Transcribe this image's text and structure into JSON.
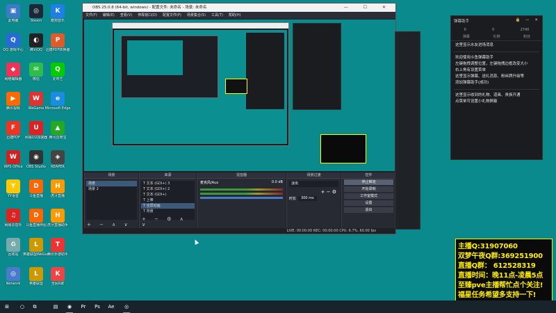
{
  "desktop_icons": [
    {
      "label": "此电脑",
      "color": "#3c7bc8",
      "glyph": "▣"
    },
    {
      "label": "Steam",
      "color": "#1b2838",
      "glyph": "◎"
    },
    {
      "label": "酷狗音乐",
      "color": "#1e7fe6",
      "glyph": "K"
    },
    {
      "label": "QQ 游戏中心",
      "color": "#2a6ad8",
      "glyph": "Q"
    },
    {
      "label": "腾讯QQ",
      "color": "#222",
      "glyph": "◐"
    },
    {
      "label": "迅捷PDF转换器",
      "color": "#e05a2a",
      "glyph": "P"
    },
    {
      "label": "网络编辑器",
      "color": "#e35",
      "glyph": "◆"
    },
    {
      "label": "微信",
      "color": "#2dbd4a",
      "glyph": "✉"
    },
    {
      "label": "爱奇艺",
      "color": "#0c0",
      "glyph": "Q"
    },
    {
      "label": "腾讯视频",
      "color": "#ff6a00",
      "glyph": "▶"
    },
    {
      "label": "WeGame",
      "color": "#d33",
      "glyph": "W"
    },
    {
      "label": "Microsoft Edge",
      "color": "#1a8de0",
      "glyph": "e"
    },
    {
      "label": "迅捷PDF",
      "color": "#e32",
      "glyph": "F"
    },
    {
      "label": "网易UU加速器",
      "color": "#d22",
      "glyph": "U"
    },
    {
      "label": "腾讯应用宝",
      "color": "#2a2",
      "glyph": "▲"
    },
    {
      "label": "WPS Office",
      "color": "#c22",
      "glyph": "W"
    },
    {
      "label": "OBS Studio",
      "color": "#333",
      "glyph": "◉"
    },
    {
      "label": "REAPER",
      "color": "#444",
      "glyph": "◈"
    },
    {
      "label": "YY语音",
      "color": "#ffc800",
      "glyph": "Y"
    },
    {
      "label": "斗鱼直播",
      "color": "#f60",
      "glyph": "D"
    },
    {
      "label": "虎牙直播",
      "color": "#f90",
      "glyph": "H"
    },
    {
      "label": "网易云音乐",
      "color": "#d22",
      "glyph": "♫"
    },
    {
      "label": "斗鱼直播伴侣",
      "color": "#f60",
      "glyph": "D"
    },
    {
      "label": "虎牙直播助手",
      "color": "#f90",
      "glyph": "H"
    },
    {
      "label": "回收站",
      "color": "#7aa",
      "glyph": "♻"
    },
    {
      "label": "英雄联盟WeGame版",
      "color": "#c90",
      "glyph": "L"
    },
    {
      "label": "腾讯手游助手",
      "color": "#e33",
      "glyph": "T"
    },
    {
      "label": "Network",
      "color": "#4a7acc",
      "glyph": "◎"
    },
    {
      "label": "英雄联盟",
      "color": "#c90",
      "glyph": "L"
    },
    {
      "label": "全民K歌",
      "color": "#e44",
      "glyph": "K"
    }
  ],
  "obs": {
    "title": "OBS 25.0.8 (64-bit, windows) - 配置文件: 未命名 - 场景: 未命名",
    "window_controls": "—  ☐  ✕",
    "menu": [
      "文件(F)",
      "编辑(E)",
      "查看(V)",
      "停靠窗口(D)",
      "配置文件(P)",
      "场景集合(S)",
      "工具(T)",
      "帮助(H)"
    ],
    "docks": {
      "scenes": {
        "header": "场景",
        "items": [
          "场景",
          "场景 2"
        ]
      },
      "sources": {
        "header": "来源",
        "items": [
          "文本 (GDI+) 3",
          "文本 (GDI+) 2",
          "文本 (GDI+)",
          "上等",
          "全屏动画",
          "背景"
        ]
      },
      "mixer": {
        "header": "混音器",
        "track": "麦克风/Aux",
        "level": "0.0 dB"
      },
      "transitions": {
        "header": "场景过渡",
        "type": "淡出",
        "duration_label": "时长",
        "duration_value": "300 ms"
      },
      "controls": {
        "header": "控件",
        "buttons": [
          "停止推流",
          "开始录制",
          "工作室模式",
          "设置",
          "退出"
        ]
      }
    },
    "status": "LIVE: 00:00:00   REC: 00:00:00   CPU: 6.7%, 60.00 fps"
  },
  "helper": {
    "title": "弹幕助手",
    "controls": "🔒 — ✕",
    "stats": [
      "0",
      "0",
      "2740"
    ],
    "tabs": [
      "弹幕",
      "礼物",
      "粉丝"
    ],
    "msg1": "这里显示水友进场消息",
    "msg2": "欢迎使用斗鱼弹幕助手\n左键拖拽调整位置，左键拖拽边框改变大小\n右上角有设置菜单\n这里显示弹幕、送礼消息、粉丝牌升级等\n添加弹幕助手(成功)",
    "msg3": "这里显示收到的礼物、道具、贵族开通\n点菜单可设置小礼物屏蔽"
  },
  "overlay": [
    "主播Q:31907060",
    "双梦午夜Q群:369251900",
    "直播Q群： 612528319",
    "直播时间：晚11点-凌晨5点",
    "至臻pve主播帮忙点个关注!",
    "福星任务希望多支持一下!"
  ],
  "taskbar": {
    "icons": [
      "⊞",
      "○",
      "⧉",
      "▤",
      "◉",
      "Pr",
      "Ps",
      "Ae",
      "◎"
    ]
  }
}
